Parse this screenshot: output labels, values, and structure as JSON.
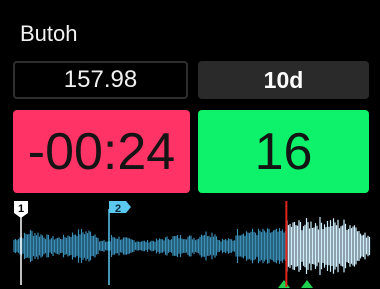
{
  "deck": {
    "track_title": "Butoh",
    "bpm": "157.98",
    "key": "10d",
    "remaining_time": "-00:24",
    "beat_counter": "16"
  },
  "cue_markers": [
    {
      "label": "1",
      "color": "#ffffff"
    },
    {
      "label": "2",
      "color": "#5bc8f0"
    }
  ],
  "colors": {
    "remaining_time_bg": "#ff3366",
    "beat_counter_bg": "#0df26a",
    "playhead": "#e0241b",
    "loop_marker": "#1fd14f",
    "waveform_played": "#3b8fb8",
    "waveform_unplayed": "#cfefff"
  },
  "icons": {
    "cue_marker": "cue-flag-icon",
    "playhead": "playhead-line-icon",
    "loop_marker": "triangle-up-icon"
  },
  "playback": {
    "position_fraction": 0.765
  }
}
